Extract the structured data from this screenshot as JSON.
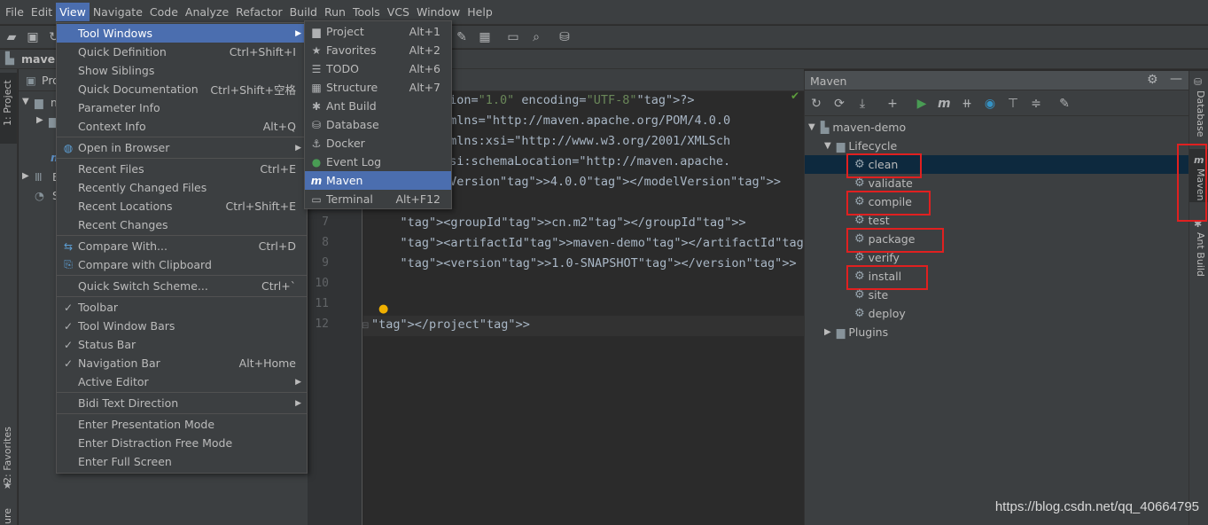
{
  "menubar": [
    "File",
    "Edit",
    "View",
    "Navigate",
    "Code",
    "Analyze",
    "Refactor",
    "Build",
    "Run",
    "Tools",
    "VCS",
    "Window",
    "Help"
  ],
  "navbar": {
    "project": "maven"
  },
  "left_stripe": {
    "project_tab": "1: Project",
    "favorites_tab": "2: Favorites",
    "structure_tab": "ure"
  },
  "project_panel": {
    "title": "Pro",
    "items": [
      "m",
      "E",
      "S"
    ]
  },
  "view_menu": {
    "items": [
      {
        "label": "Tool Windows",
        "shortcut": "",
        "submenu": true,
        "selected": true
      },
      {
        "label": "Quick Definition",
        "shortcut": "Ctrl+Shift+I"
      },
      {
        "label": "Show Siblings",
        "shortcut": ""
      },
      {
        "label": "Quick Documentation",
        "shortcut": "Ctrl+Shift+空格"
      },
      {
        "label": "Parameter Info",
        "shortcut": ""
      },
      {
        "label": "Context Info",
        "shortcut": "Alt+Q"
      },
      {
        "label": "Open in Browser",
        "shortcut": "",
        "submenu": true
      },
      {
        "label": "Recent Files",
        "shortcut": "Ctrl+E"
      },
      {
        "label": "Recently Changed Files",
        "shortcut": ""
      },
      {
        "label": "Recent Locations",
        "shortcut": "Ctrl+Shift+E"
      },
      {
        "label": "Recent Changes",
        "shortcut": ""
      },
      {
        "label": "Compare With...",
        "shortcut": "Ctrl+D"
      },
      {
        "label": "Compare with Clipboard",
        "shortcut": ""
      },
      {
        "label": "Quick Switch Scheme...",
        "shortcut": "Ctrl+`"
      },
      {
        "label": "Toolbar",
        "shortcut": "",
        "checked": true
      },
      {
        "label": "Tool Window Bars",
        "shortcut": "",
        "checked": true
      },
      {
        "label": "Status Bar",
        "shortcut": "",
        "checked": true
      },
      {
        "label": "Navigation Bar",
        "shortcut": "Alt+Home",
        "checked": true
      },
      {
        "label": "Active Editor",
        "shortcut": "",
        "submenu": true
      },
      {
        "label": "Bidi Text Direction",
        "shortcut": "",
        "submenu": true
      },
      {
        "label": "Enter Presentation Mode",
        "shortcut": ""
      },
      {
        "label": "Enter Distraction Free Mode",
        "shortcut": ""
      },
      {
        "label": "Enter Full Screen",
        "shortcut": ""
      }
    ]
  },
  "tool_windows_menu": {
    "items": [
      {
        "label": "Project",
        "shortcut": "Alt+1",
        "icon": "folder-icon"
      },
      {
        "label": "Favorites",
        "shortcut": "Alt+2",
        "icon": "star-icon"
      },
      {
        "label": "TODO",
        "shortcut": "Alt+6",
        "icon": "list-icon"
      },
      {
        "label": "Structure",
        "shortcut": "Alt+7",
        "icon": "structure-icon"
      },
      {
        "label": "Ant Build",
        "shortcut": "",
        "icon": "ant-icon"
      },
      {
        "label": "Database",
        "shortcut": "",
        "icon": "database-icon"
      },
      {
        "label": "Docker",
        "shortcut": "",
        "icon": "docker-icon"
      },
      {
        "label": "Event Log",
        "shortcut": "",
        "icon": "event-log-icon"
      },
      {
        "label": "Maven",
        "shortcut": "",
        "icon": "maven-icon",
        "selected": true
      },
      {
        "label": "Terminal",
        "shortcut": "Alt+F12",
        "icon": "terminal-icon"
      }
    ]
  },
  "editor": {
    "lines": [
      {
        "num": "",
        "text": "sion=\"1.0\" encoding=\"UTF-8\"?>"
      },
      {
        "num": "",
        "text": "xmlns=\"http://maven.apache.org/POM/4.0.0"
      },
      {
        "num": "",
        "text": "xmlns:xsi=\"http://www.w3.org/2001/XMLSch"
      },
      {
        "num": "",
        "text": "xsi:schemaLocation=\"http://maven.apache."
      },
      {
        "num": "",
        "text": "lVersion>4.0.0</modelVersion>"
      },
      {
        "num": "",
        "text": ""
      },
      {
        "num": "7",
        "text": "    <groupId>cn.m2</groupId>"
      },
      {
        "num": "8",
        "text": "    <artifactId>maven-demo</artifactId>"
      },
      {
        "num": "9",
        "text": "    <version>1.0-SNAPSHOT</version>"
      },
      {
        "num": "10",
        "text": ""
      },
      {
        "num": "11",
        "text": ""
      },
      {
        "num": "12",
        "text": "</project>"
      }
    ]
  },
  "maven_panel": {
    "title": "Maven",
    "project": "maven-demo",
    "lifecycle_label": "Lifecycle",
    "phases": [
      "clean",
      "validate",
      "compile",
      "test",
      "package",
      "verify",
      "install",
      "site",
      "deploy"
    ],
    "highlighted": [
      "clean",
      "compile",
      "package",
      "install"
    ],
    "selected": "clean",
    "plugins_label": "Plugins"
  },
  "right_stripe": {
    "database_tab": "Database",
    "maven_tab": "Maven",
    "ant_tab": "Ant Build"
  },
  "watermark": "https://blog.csdn.net/qq_40664795",
  "colors": {
    "highlight": "#e02020",
    "selection": "#4b6eaf",
    "background": "#2b2b2b"
  }
}
